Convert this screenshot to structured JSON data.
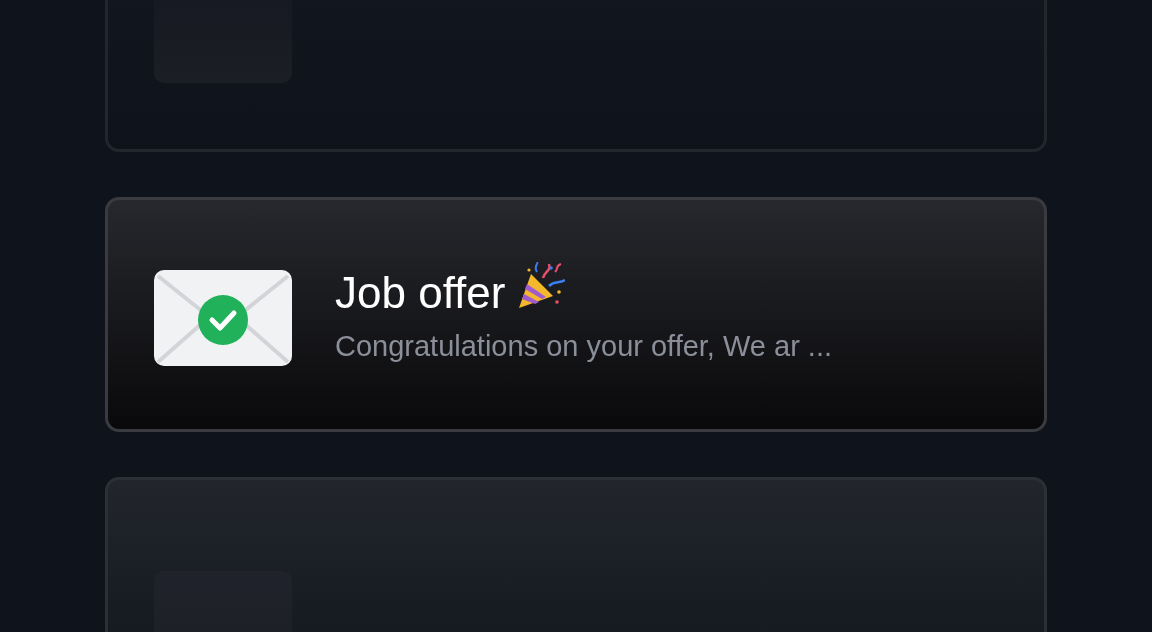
{
  "cards": [
    {
      "kind": "placeholder",
      "selected": false
    },
    {
      "kind": "message",
      "selected": true,
      "title": "Job offer",
      "preview": "Congratulations on your offer, We ar ..."
    },
    {
      "kind": "placeholder",
      "selected": false
    }
  ]
}
